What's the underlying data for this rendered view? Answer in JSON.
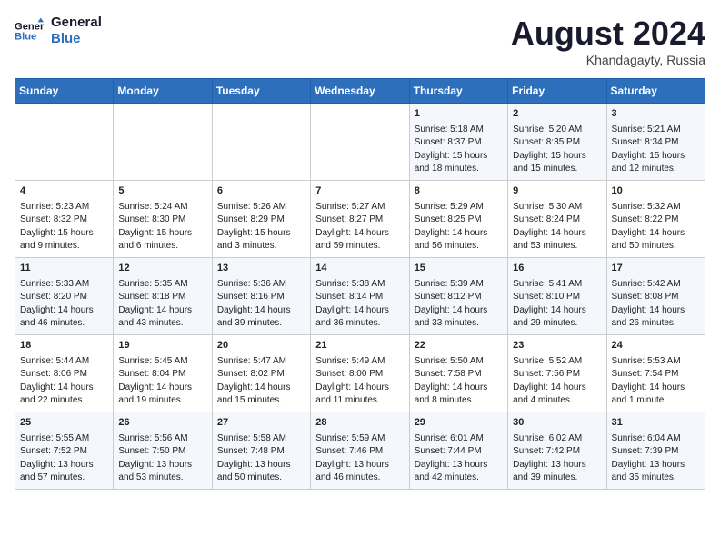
{
  "header": {
    "logo_line1": "General",
    "logo_line2": "Blue",
    "month_year": "August 2024",
    "location": "Khandagayty, Russia"
  },
  "days_of_week": [
    "Sunday",
    "Monday",
    "Tuesday",
    "Wednesday",
    "Thursday",
    "Friday",
    "Saturday"
  ],
  "weeks": [
    [
      {
        "day": "",
        "sunrise": "",
        "sunset": "",
        "daylight": ""
      },
      {
        "day": "",
        "sunrise": "",
        "sunset": "",
        "daylight": ""
      },
      {
        "day": "",
        "sunrise": "",
        "sunset": "",
        "daylight": ""
      },
      {
        "day": "",
        "sunrise": "",
        "sunset": "",
        "daylight": ""
      },
      {
        "day": "1",
        "sunrise": "Sunrise: 5:18 AM",
        "sunset": "Sunset: 8:37 PM",
        "daylight": "Daylight: 15 hours and 18 minutes."
      },
      {
        "day": "2",
        "sunrise": "Sunrise: 5:20 AM",
        "sunset": "Sunset: 8:35 PM",
        "daylight": "Daylight: 15 hours and 15 minutes."
      },
      {
        "day": "3",
        "sunrise": "Sunrise: 5:21 AM",
        "sunset": "Sunset: 8:34 PM",
        "daylight": "Daylight: 15 hours and 12 minutes."
      }
    ],
    [
      {
        "day": "4",
        "sunrise": "Sunrise: 5:23 AM",
        "sunset": "Sunset: 8:32 PM",
        "daylight": "Daylight: 15 hours and 9 minutes."
      },
      {
        "day": "5",
        "sunrise": "Sunrise: 5:24 AM",
        "sunset": "Sunset: 8:30 PM",
        "daylight": "Daylight: 15 hours and 6 minutes."
      },
      {
        "day": "6",
        "sunrise": "Sunrise: 5:26 AM",
        "sunset": "Sunset: 8:29 PM",
        "daylight": "Daylight: 15 hours and 3 minutes."
      },
      {
        "day": "7",
        "sunrise": "Sunrise: 5:27 AM",
        "sunset": "Sunset: 8:27 PM",
        "daylight": "Daylight: 14 hours and 59 minutes."
      },
      {
        "day": "8",
        "sunrise": "Sunrise: 5:29 AM",
        "sunset": "Sunset: 8:25 PM",
        "daylight": "Daylight: 14 hours and 56 minutes."
      },
      {
        "day": "9",
        "sunrise": "Sunrise: 5:30 AM",
        "sunset": "Sunset: 8:24 PM",
        "daylight": "Daylight: 14 hours and 53 minutes."
      },
      {
        "day": "10",
        "sunrise": "Sunrise: 5:32 AM",
        "sunset": "Sunset: 8:22 PM",
        "daylight": "Daylight: 14 hours and 50 minutes."
      }
    ],
    [
      {
        "day": "11",
        "sunrise": "Sunrise: 5:33 AM",
        "sunset": "Sunset: 8:20 PM",
        "daylight": "Daylight: 14 hours and 46 minutes."
      },
      {
        "day": "12",
        "sunrise": "Sunrise: 5:35 AM",
        "sunset": "Sunset: 8:18 PM",
        "daylight": "Daylight: 14 hours and 43 minutes."
      },
      {
        "day": "13",
        "sunrise": "Sunrise: 5:36 AM",
        "sunset": "Sunset: 8:16 PM",
        "daylight": "Daylight: 14 hours and 39 minutes."
      },
      {
        "day": "14",
        "sunrise": "Sunrise: 5:38 AM",
        "sunset": "Sunset: 8:14 PM",
        "daylight": "Daylight: 14 hours and 36 minutes."
      },
      {
        "day": "15",
        "sunrise": "Sunrise: 5:39 AM",
        "sunset": "Sunset: 8:12 PM",
        "daylight": "Daylight: 14 hours and 33 minutes."
      },
      {
        "day": "16",
        "sunrise": "Sunrise: 5:41 AM",
        "sunset": "Sunset: 8:10 PM",
        "daylight": "Daylight: 14 hours and 29 minutes."
      },
      {
        "day": "17",
        "sunrise": "Sunrise: 5:42 AM",
        "sunset": "Sunset: 8:08 PM",
        "daylight": "Daylight: 14 hours and 26 minutes."
      }
    ],
    [
      {
        "day": "18",
        "sunrise": "Sunrise: 5:44 AM",
        "sunset": "Sunset: 8:06 PM",
        "daylight": "Daylight: 14 hours and 22 minutes."
      },
      {
        "day": "19",
        "sunrise": "Sunrise: 5:45 AM",
        "sunset": "Sunset: 8:04 PM",
        "daylight": "Daylight: 14 hours and 19 minutes."
      },
      {
        "day": "20",
        "sunrise": "Sunrise: 5:47 AM",
        "sunset": "Sunset: 8:02 PM",
        "daylight": "Daylight: 14 hours and 15 minutes."
      },
      {
        "day": "21",
        "sunrise": "Sunrise: 5:49 AM",
        "sunset": "Sunset: 8:00 PM",
        "daylight": "Daylight: 14 hours and 11 minutes."
      },
      {
        "day": "22",
        "sunrise": "Sunrise: 5:50 AM",
        "sunset": "Sunset: 7:58 PM",
        "daylight": "Daylight: 14 hours and 8 minutes."
      },
      {
        "day": "23",
        "sunrise": "Sunrise: 5:52 AM",
        "sunset": "Sunset: 7:56 PM",
        "daylight": "Daylight: 14 hours and 4 minutes."
      },
      {
        "day": "24",
        "sunrise": "Sunrise: 5:53 AM",
        "sunset": "Sunset: 7:54 PM",
        "daylight": "Daylight: 14 hours and 1 minute."
      }
    ],
    [
      {
        "day": "25",
        "sunrise": "Sunrise: 5:55 AM",
        "sunset": "Sunset: 7:52 PM",
        "daylight": "Daylight: 13 hours and 57 minutes."
      },
      {
        "day": "26",
        "sunrise": "Sunrise: 5:56 AM",
        "sunset": "Sunset: 7:50 PM",
        "daylight": "Daylight: 13 hours and 53 minutes."
      },
      {
        "day": "27",
        "sunrise": "Sunrise: 5:58 AM",
        "sunset": "Sunset: 7:48 PM",
        "daylight": "Daylight: 13 hours and 50 minutes."
      },
      {
        "day": "28",
        "sunrise": "Sunrise: 5:59 AM",
        "sunset": "Sunset: 7:46 PM",
        "daylight": "Daylight: 13 hours and 46 minutes."
      },
      {
        "day": "29",
        "sunrise": "Sunrise: 6:01 AM",
        "sunset": "Sunset: 7:44 PM",
        "daylight": "Daylight: 13 hours and 42 minutes."
      },
      {
        "day": "30",
        "sunrise": "Sunrise: 6:02 AM",
        "sunset": "Sunset: 7:42 PM",
        "daylight": "Daylight: 13 hours and 39 minutes."
      },
      {
        "day": "31",
        "sunrise": "Sunrise: 6:04 AM",
        "sunset": "Sunset: 7:39 PM",
        "daylight": "Daylight: 13 hours and 35 minutes."
      }
    ]
  ]
}
